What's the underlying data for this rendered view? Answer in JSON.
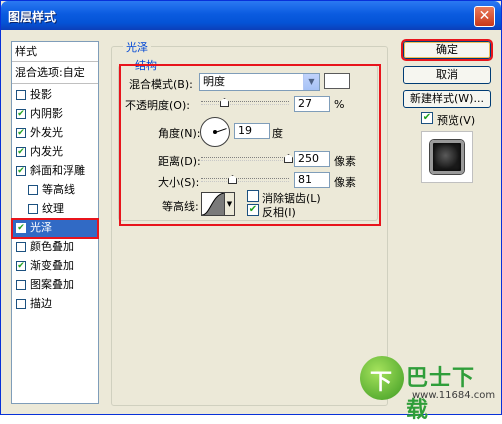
{
  "window": {
    "title": "图层样式"
  },
  "stylelist": {
    "header": "样式",
    "blend_options": "混合选项:自定",
    "items": [
      {
        "label": "投影",
        "checked": false,
        "indent": false
      },
      {
        "label": "内阴影",
        "checked": true,
        "indent": false
      },
      {
        "label": "外发光",
        "checked": true,
        "indent": false
      },
      {
        "label": "内发光",
        "checked": true,
        "indent": false
      },
      {
        "label": "斜面和浮雕",
        "checked": true,
        "indent": false
      },
      {
        "label": "等高线",
        "checked": false,
        "indent": true
      },
      {
        "label": "纹理",
        "checked": false,
        "indent": true
      },
      {
        "label": "光泽",
        "checked": true,
        "indent": false,
        "selected": true
      },
      {
        "label": "颜色叠加",
        "checked": false,
        "indent": false
      },
      {
        "label": "渐变叠加",
        "checked": true,
        "indent": false
      },
      {
        "label": "图案叠加",
        "checked": false,
        "indent": false
      },
      {
        "label": "描边",
        "checked": false,
        "indent": false
      }
    ]
  },
  "satin": {
    "section_title": "光泽",
    "structure_title": "结构",
    "blend_mode_label": "混合模式(B):",
    "blend_mode_value": "明度",
    "opacity_label": "不透明度(O):",
    "opacity_value": "27",
    "opacity_unit": "%",
    "angle_label": "角度(N):",
    "angle_value": "19",
    "angle_unit": "度",
    "distance_label": "距离(D):",
    "distance_value": "250",
    "distance_unit": "像素",
    "size_label": "大小(S):",
    "size_value": "81",
    "size_unit": "像素",
    "contour_label": "等高线:",
    "antialias_label": "消除锯齿(L)",
    "antialias_checked": false,
    "invert_label": "反相(I)",
    "invert_checked": true
  },
  "buttons": {
    "ok": "确定",
    "cancel": "取消",
    "new_style": "新建样式(W)...",
    "preview_label": "预览(V)",
    "preview_checked": true
  },
  "watermark": {
    "logo_char": "下",
    "name": "巴士下载",
    "site": "www.11684.com"
  },
  "colors": {
    "accent_red": "#E8141C",
    "selection_blue": "#316AC5",
    "xp_title_blue": "#0A5BE0"
  }
}
